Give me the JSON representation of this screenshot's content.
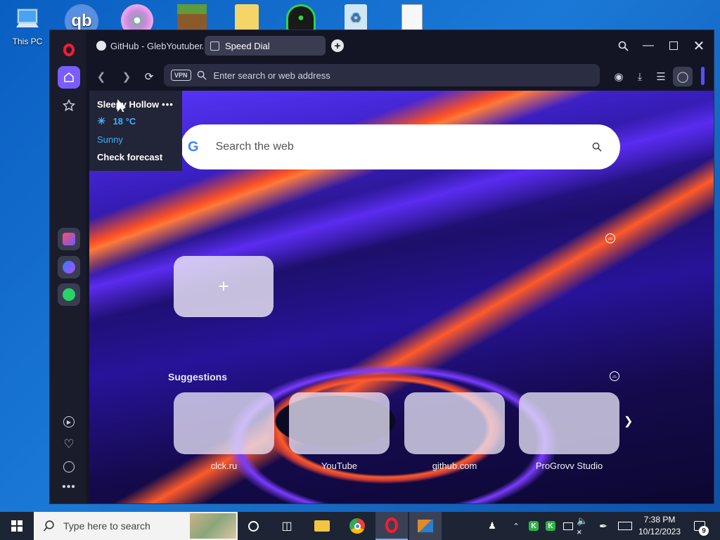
{
  "desktop": {
    "icons": [
      {
        "label": "This PC",
        "icon": "computer-icon"
      },
      {
        "label": "",
        "icon": "qbittorrent-icon"
      },
      {
        "label": "",
        "icon": "disc-icon"
      },
      {
        "label": "",
        "icon": "minecraft-icon"
      },
      {
        "label": "",
        "icon": "folder-icon"
      },
      {
        "label": "",
        "icon": "wifi-lock-icon"
      },
      {
        "label": "",
        "icon": "recycle-bin-icon"
      },
      {
        "label": "",
        "icon": "document-icon"
      }
    ]
  },
  "browser": {
    "tabs": [
      {
        "label": "GitHub - GlebYoutuber/W",
        "active": false,
        "icon": "github-icon"
      },
      {
        "label": "Speed Dial",
        "active": true,
        "icon": "speed-dial-icon"
      }
    ],
    "address": {
      "vpn_label": "VPN",
      "placeholder": "Enter search or web address"
    },
    "sidebar_icons": [
      "opera-icon",
      "home-icon",
      "star-icon",
      "aria-icon",
      "messenger-icon",
      "whatsapp-icon",
      "play-icon",
      "heart-icon",
      "clock-icon",
      "more-icon"
    ],
    "weather": {
      "location": "Sleepy Hollow",
      "temp": "18 °C",
      "condition": "Sunny",
      "forecast_link": "Check forecast"
    },
    "search": {
      "placeholder": "Search the web"
    },
    "speed_dial": {
      "add_symbol": "+"
    },
    "suggestions": {
      "title": "Suggestions",
      "items": [
        {
          "label": "clck.ru"
        },
        {
          "label": "YouTube"
        },
        {
          "label": "github.com"
        },
        {
          "label": "ProGrovv Studio"
        }
      ]
    }
  },
  "taskbar": {
    "search_placeholder": "Type here to search",
    "time": "7:38 PM",
    "date": "10/12/2023",
    "notification_count": "9"
  },
  "colors": {
    "accent": "#7b5cff",
    "opera_red": "#ff1b2d",
    "taskbar": "#1d2433"
  }
}
